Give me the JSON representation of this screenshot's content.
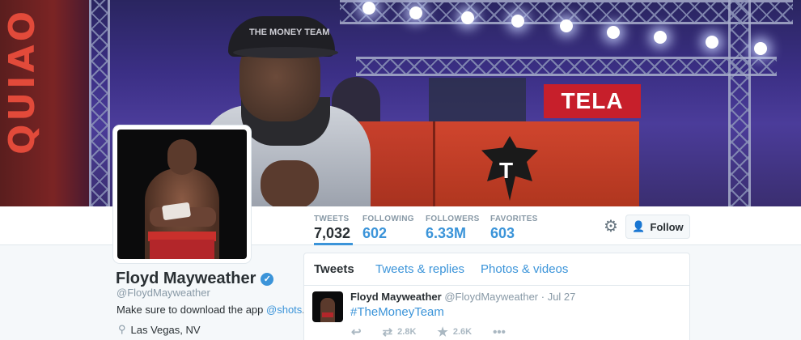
{
  "banner": {
    "sign_text": "TELA",
    "cap_text": "THE MONEY TEAM",
    "left_letters": "QUIAO"
  },
  "stats": [
    {
      "label": "TWEETS",
      "value": "7,032"
    },
    {
      "label": "FOLLOWING",
      "value": "602"
    },
    {
      "label": "FOLLOWERS",
      "value": "6.33M"
    },
    {
      "label": "FAVORITES",
      "value": "603"
    }
  ],
  "header_actions": {
    "settings_icon": "gear-icon",
    "follow_label": "Follow",
    "follow_icon": "add-user-icon"
  },
  "profile": {
    "name": "Floyd Mayweather",
    "handle": "@FloydMayweather",
    "bio_text": "Make sure to download the app ",
    "bio_link": "@shots",
    "bio_end": ".",
    "location": "Las Vegas, NV"
  },
  "timeline": {
    "tabs": [
      "Tweets",
      "Tweets & replies",
      "Photos & videos"
    ],
    "tweet": {
      "name": "Floyd Mayweather",
      "handle": "@FloydMayweather",
      "date": "· Jul 27",
      "text": "#TheMoneyTeam",
      "retweets": "2.8K",
      "favorites": "2.6K"
    }
  },
  "colors": {
    "accent": "#3b94d9",
    "text": "#292f33",
    "muted": "#8899a6"
  }
}
